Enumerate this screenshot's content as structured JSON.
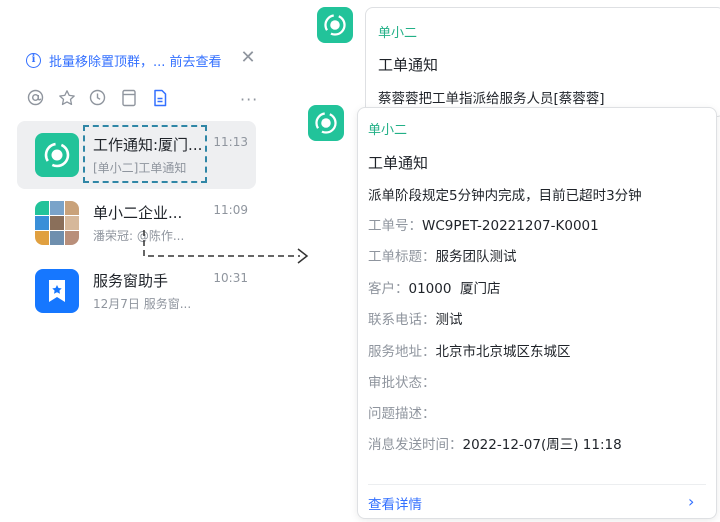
{
  "notice": {
    "text": "批量移除置顶群，... 前去查看"
  },
  "chats": [
    {
      "title": "工作通知:厦门...",
      "time": "11:13",
      "subtitle": "[单小二]工单通知"
    },
    {
      "title": "单小二企业...",
      "time": "11:09",
      "subtitle": "潘荣冠: @陈作..."
    },
    {
      "title": "服务窗助手",
      "time": "10:31",
      "subtitle": "12月7日 服务窗..."
    }
  ],
  "back_card": {
    "sender": "单小二",
    "title": "工单通知",
    "body": "蔡蓉蓉把工单指派给服务人员[蔡蓉蓉]"
  },
  "front_card": {
    "sender": "单小二",
    "title": "工单通知",
    "warning": "派单阶段规定5分钟内完成，目前已超时3分钟",
    "fields": [
      {
        "label": "工单号：",
        "value": "WC9PET-20221207-K0001"
      },
      {
        "label": "工单标题：",
        "value": "服务团队测试"
      },
      {
        "label": "客户：",
        "value": "01000  厦门店"
      },
      {
        "label": "联系电话：",
        "value": "测试"
      },
      {
        "label": "服务地址：",
        "value": "北京市北京城区东城区"
      },
      {
        "label": "审批状态：",
        "value": ""
      },
      {
        "label": "问题描述：",
        "value": ""
      },
      {
        "label": "消息发送时间：",
        "value": "2022-12-07(周三) 11:18"
      }
    ],
    "detail_link": "查看详情"
  },
  "icons": [
    "info-icon",
    "close-icon",
    "at-icon",
    "star-icon",
    "clock-icon",
    "archive-icon",
    "doc-icon",
    "more-icon",
    "bot-icon",
    "service-window-icon",
    "chevron-right-icon"
  ],
  "colors": {
    "accent_blue": "#3370ff",
    "bot_green": "#22c39a",
    "active_bg": "#eeeff1",
    "dash": "#2f86a6"
  }
}
